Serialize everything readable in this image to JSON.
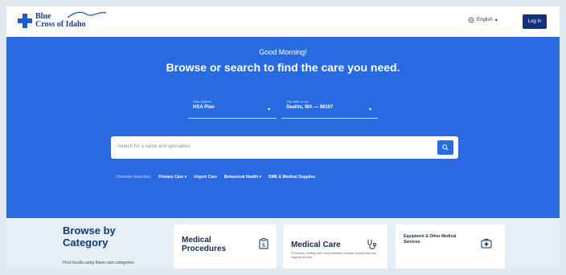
{
  "header": {
    "logo_line1": "Blue",
    "logo_line2": "Cross of Idaho",
    "language": "English",
    "login_label": "Log In"
  },
  "hero": {
    "greeting": "Good Morning!",
    "headline": "Browse or search to find the care you need.",
    "plan_label": "Plan Options",
    "plan_value": "HSA Plan",
    "location_label": "City state or zip",
    "location_value": "Seattle, WA — 98107",
    "search_placeholder": "Search for a name and specialties",
    "common_searches_label": "Common Searches:",
    "common_searches": [
      "Primary Care",
      "Urgent Care",
      "Behavioral Health",
      "DME & Medical Supplies"
    ]
  },
  "categories": {
    "title": "Browse by Category",
    "subtitle": "Find results using these care categories",
    "cards": [
      {
        "title": "Medical Procedures",
        "icon": "clipboard-dollar-icon",
        "description": ""
      },
      {
        "title": "Medical Care",
        "icon": "stethoscope-icon",
        "description": "Preventing, treating, and curing diseases, includes medical care and ongoing services."
      },
      {
        "title": "Equipment & Other Medical Services",
        "icon": "first-aid-kit-icon",
        "description": ""
      }
    ]
  },
  "colors": {
    "brand_blue": "#2a6ae0",
    "navy": "#12317a",
    "category_bg": "#e6eef6"
  }
}
